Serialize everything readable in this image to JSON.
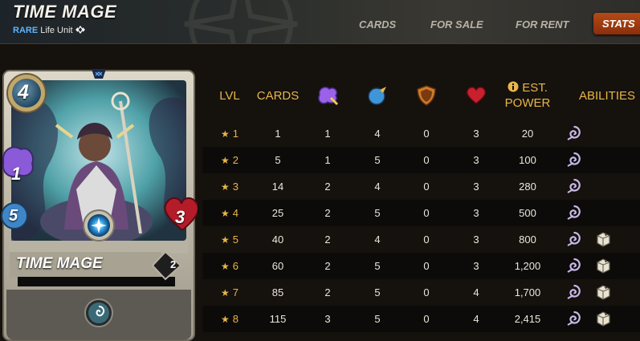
{
  "header": {
    "title": "TIME MAGE",
    "rarity": "RARE",
    "subtitle": "Life Unit",
    "edition_icon": "edition-diamond-icon",
    "tabs": [
      {
        "label": "CARDS",
        "active": false
      },
      {
        "label": "FOR SALE",
        "active": false
      },
      {
        "label": "FOR RENT",
        "active": false
      },
      {
        "label": "STATS",
        "active": true
      }
    ]
  },
  "card": {
    "name": "TIME MAGE",
    "mana": "4",
    "magic": "1",
    "speed": "5",
    "health": "3",
    "level": "2",
    "ability_icon": "slow-spiral-icon",
    "colors": {
      "frame": "#c9c3b3",
      "mana": "#3b6a8a",
      "health": "#b51c2a",
      "speed": "#3e86c8",
      "magic": "#8a5ad8"
    }
  },
  "table": {
    "headers": {
      "lvl": "LVL",
      "cards": "CARDS",
      "magic_icon": "magic-attack-icon",
      "speed_icon": "speed-icon",
      "armor_icon": "armor-shield-icon",
      "health_icon": "health-heart-icon",
      "est_power_icon": "info-icon",
      "est_power_line1": "EST.",
      "est_power_line2": "POWER",
      "abilities": "ABILITIES"
    },
    "rows": [
      {
        "lvl": "1",
        "cards": "1",
        "magic": "1",
        "speed": "4",
        "armor": "0",
        "health": "3",
        "power": "20",
        "abilities": [
          "slow-spiral-icon"
        ]
      },
      {
        "lvl": "2",
        "cards": "5",
        "magic": "1",
        "speed": "5",
        "armor": "0",
        "health": "3",
        "power": "100",
        "abilities": [
          "slow-spiral-icon"
        ]
      },
      {
        "lvl": "3",
        "cards": "14",
        "magic": "2",
        "speed": "4",
        "armor": "0",
        "health": "3",
        "power": "280",
        "abilities": [
          "slow-spiral-icon"
        ]
      },
      {
        "lvl": "4",
        "cards": "25",
        "magic": "2",
        "speed": "5",
        "armor": "0",
        "health": "3",
        "power": "500",
        "abilities": [
          "slow-spiral-icon"
        ]
      },
      {
        "lvl": "5",
        "cards": "40",
        "magic": "2",
        "speed": "4",
        "armor": "0",
        "health": "3",
        "power": "800",
        "abilities": [
          "slow-spiral-icon",
          "hourglass-cube-icon"
        ]
      },
      {
        "lvl": "6",
        "cards": "60",
        "magic": "2",
        "speed": "5",
        "armor": "0",
        "health": "3",
        "power": "1,200",
        "abilities": [
          "slow-spiral-icon",
          "hourglass-cube-icon"
        ]
      },
      {
        "lvl": "7",
        "cards": "85",
        "magic": "2",
        "speed": "5",
        "armor": "0",
        "health": "4",
        "power": "1,700",
        "abilities": [
          "slow-spiral-icon",
          "hourglass-cube-icon"
        ]
      },
      {
        "lvl": "8",
        "cards": "115",
        "magic": "3",
        "speed": "5",
        "armor": "0",
        "health": "4",
        "power": "2,415",
        "abilities": [
          "slow-spiral-icon",
          "hourglass-cube-icon"
        ]
      }
    ]
  }
}
